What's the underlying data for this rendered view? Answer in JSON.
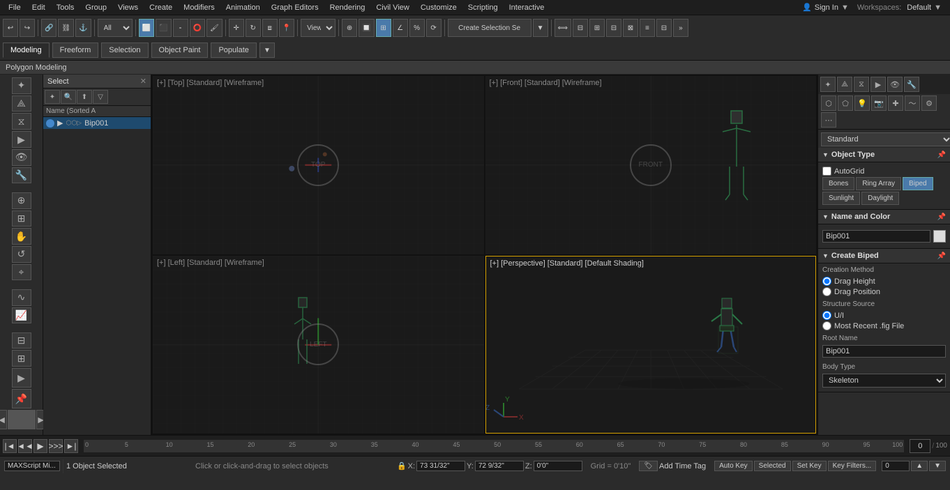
{
  "menubar": {
    "items": [
      "File",
      "Edit",
      "Tools",
      "Group",
      "Views",
      "Create",
      "Modifiers",
      "Animation",
      "Graph Editors",
      "Rendering",
      "Civil View",
      "Customize",
      "Scripting",
      "Interactive"
    ]
  },
  "toolbar": {
    "selection_set_label": "Create Selection Se",
    "all_option": "All",
    "view_option": "View"
  },
  "tabs": {
    "modeling": "Modeling",
    "freeform": "Freeform",
    "selection": "Selection",
    "object_paint": "Object Paint",
    "populate": "Populate"
  },
  "poly_modeling_bar": "Polygon Modeling",
  "scene_explorer": {
    "title": "Select",
    "col_header": "Name (Sorted A",
    "items": [
      {
        "name": "Bip001",
        "selected": true
      }
    ]
  },
  "viewports": [
    {
      "label": "[+] [Top] [Standard] [Wireframe]",
      "type": "top",
      "active": false
    },
    {
      "label": "[+] [Front] [Standard] [Wireframe]",
      "type": "front",
      "active": false
    },
    {
      "label": "[+] [Left] [Standard] [Wireframe]",
      "type": "left",
      "active": false
    },
    {
      "label": "[+] [Perspective] [Standard] [Default Shading]",
      "type": "perspective",
      "active": true
    }
  ],
  "right_panel": {
    "standard_label": "Standard",
    "sections": {
      "object_type": {
        "title": "Object Type",
        "autogrid": "AutoGrid",
        "buttons": [
          "Bones",
          "Ring Array",
          "Biped",
          "Sunlight",
          "Daylight"
        ]
      },
      "name_and_color": {
        "title": "Name and Color",
        "name_value": "Bip001"
      },
      "create_biped": {
        "title": "Create Biped",
        "creation_method_label": "Creation Method",
        "drag_height": "Drag Height",
        "drag_position": "Drag Position",
        "structure_source_label": "Structure Source",
        "ui_option": "U/I",
        "fig_option": "Most Recent .fig File",
        "root_name_label": "Root Name",
        "root_name_value": "Bip001",
        "body_type_label": "Body Type",
        "body_type_value": "Skeleton"
      }
    }
  },
  "status_bar": {
    "selection_text": "1 Object Selected",
    "hint_text": "Click or click-and-drag to select objects",
    "x_coord": "X: 73 31/32\"",
    "y_coord": "Y: 72 9/32\"",
    "z_coord": "Z: 0'0\"",
    "grid_text": "Grid = 0'10\"",
    "time_value": "0",
    "max_time": "100",
    "script_mini": "MAXScript Mi..."
  },
  "timeline": {
    "current": "0",
    "max": "100",
    "ticks": [
      "0",
      "5",
      "10",
      "15",
      "20",
      "25",
      "30",
      "35",
      "40",
      "45",
      "50",
      "55",
      "60",
      "65",
      "70",
      "75",
      "80",
      "85",
      "90",
      "95",
      "100"
    ]
  },
  "workspace": "Default",
  "sign_in": "Sign In",
  "workspaces_label": "Workspaces:",
  "add_time_tag": "Add Time Tag"
}
